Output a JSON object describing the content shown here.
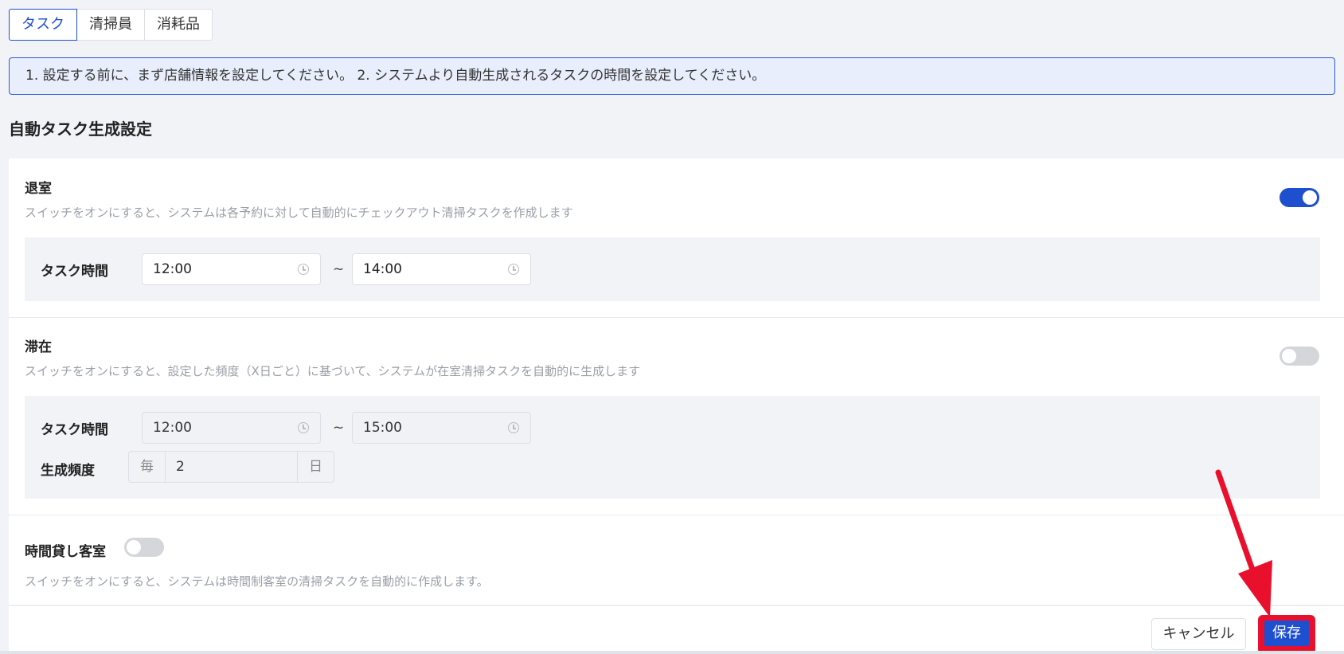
{
  "tabs": [
    {
      "label": "タスク",
      "active": true
    },
    {
      "label": "清掃員",
      "active": false
    },
    {
      "label": "消耗品",
      "active": false
    }
  ],
  "notice": "1. 設定する前に、まず店舗情報を設定してください。 2. システムより自動生成されるタスクの時間を設定してください。",
  "section_title": "自動タスク生成設定",
  "checkout": {
    "title": "退室",
    "description": "スイッチをオンにすると、システムは各予約に対して自動的にチェックアウト清掃タスクを作成します",
    "enabled": true,
    "task_time_label": "タスク時間",
    "start": "12:00",
    "end": "14:00",
    "separator": "~"
  },
  "stay": {
    "title": "滞在",
    "description": "スイッチをオンにすると、設定した頻度（X日ごと）に基づいて、システムが在室清掃タスクを自動的に生成します",
    "enabled": false,
    "task_time_label": "タスク時間",
    "start": "12:00",
    "end": "15:00",
    "separator": "~",
    "frequency_label": "生成頻度",
    "frequency_prefix": "毎",
    "frequency_value": "2",
    "frequency_suffix": "日"
  },
  "hourly": {
    "title": "時間貸し客室",
    "description": "スイッチをオンにすると、システムは時間制客室の清掃タスクを自動的に作成します。",
    "enabled": false
  },
  "buttons": {
    "cancel": "キャンセル",
    "save": "保存"
  },
  "colors": {
    "accent": "#1e4fcf",
    "highlight": "#e8102c"
  }
}
